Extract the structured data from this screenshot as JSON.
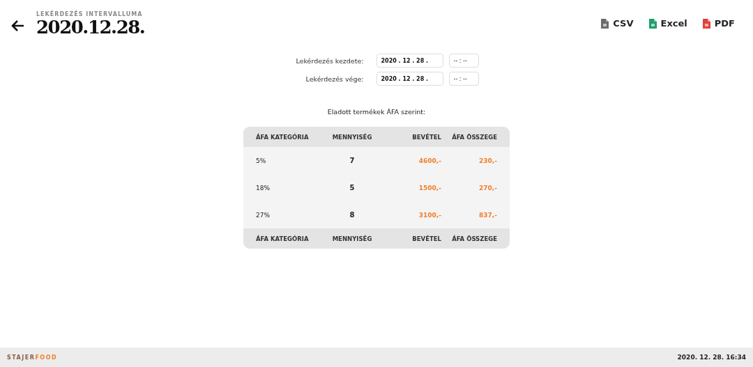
{
  "header": {
    "subtitle": "LEKÉRDEZÉS INTERVALLUMA",
    "title": "2020.12.28."
  },
  "exports": [
    {
      "kind": "csv",
      "label": "CSV"
    },
    {
      "kind": "excel",
      "label": "Excel"
    },
    {
      "kind": "pdf",
      "label": "PDF"
    }
  ],
  "query": [
    {
      "label": "Lekérdezés kezdete:",
      "date": "2020 . 12 . 28 .",
      "time": "-- : --"
    },
    {
      "label": "Lekérdezés vége:",
      "date": "2020 . 12 . 28 .",
      "time": "-- : --"
    }
  ],
  "table": {
    "caption": "Eladott termékek ÁFA szerint:",
    "columns": [
      "ÁFA KATEGÓRIA",
      "MENNYISÉG",
      "BEVÉTEL",
      "ÁFA ÖSSZEGE"
    ],
    "rows": [
      [
        "5%",
        "7",
        "4600,-",
        "230,-"
      ],
      [
        "18%",
        "5",
        "1500,-",
        "270,-"
      ],
      [
        "27%",
        "8",
        "3100,-",
        "837,-"
      ]
    ],
    "footer": [
      "ÁFA KATEGÓRIA",
      "MENNYISÉG",
      "BEVÉTEL",
      "ÁFA ÖSSZEGE"
    ]
  },
  "status_bar": {
    "brand_1": "STAJER",
    "brand_2": "FOOD",
    "datetime": "2020. 12. 28. 16:34"
  }
}
